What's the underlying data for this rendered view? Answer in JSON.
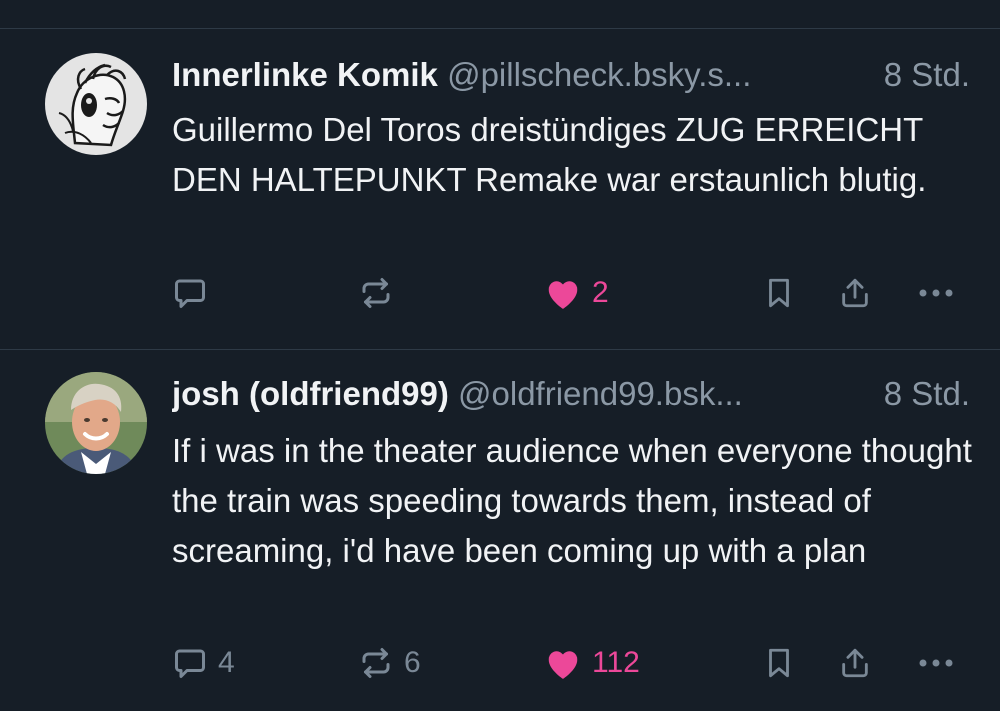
{
  "posts": [
    {
      "author_name": "Innerlinke Komik",
      "handle": "@pillscheck.bsky.s...",
      "time": "8 Std.",
      "text": "Guillermo Del Toros dreistündiges ZUG ERREICHT DEN HALTEPUNKT Remake war erstaunlich blutig.",
      "reply_count": "",
      "repost_count": "",
      "like_count": "2",
      "liked": true
    },
    {
      "author_name": "josh (oldfriend99)",
      "handle": "@oldfriend99.bsk...",
      "time": "8 Std.",
      "text": "If i was in the theater audience when everyone thought the train was speeding towards them, instead of screaming, i'd have been coming up with a plan",
      "reply_count": "4",
      "repost_count": "6",
      "like_count": "112",
      "liked": true
    }
  ],
  "colors": {
    "background": "#161e27",
    "text": "#f1f3f5",
    "muted": "#8b98a5",
    "icon": "#7a8896",
    "like": "#ec4899",
    "divider": "#2e3a46"
  },
  "icons": [
    "reply-icon",
    "repost-icon",
    "heart-icon",
    "bookmark-icon",
    "share-icon",
    "more-icon"
  ]
}
